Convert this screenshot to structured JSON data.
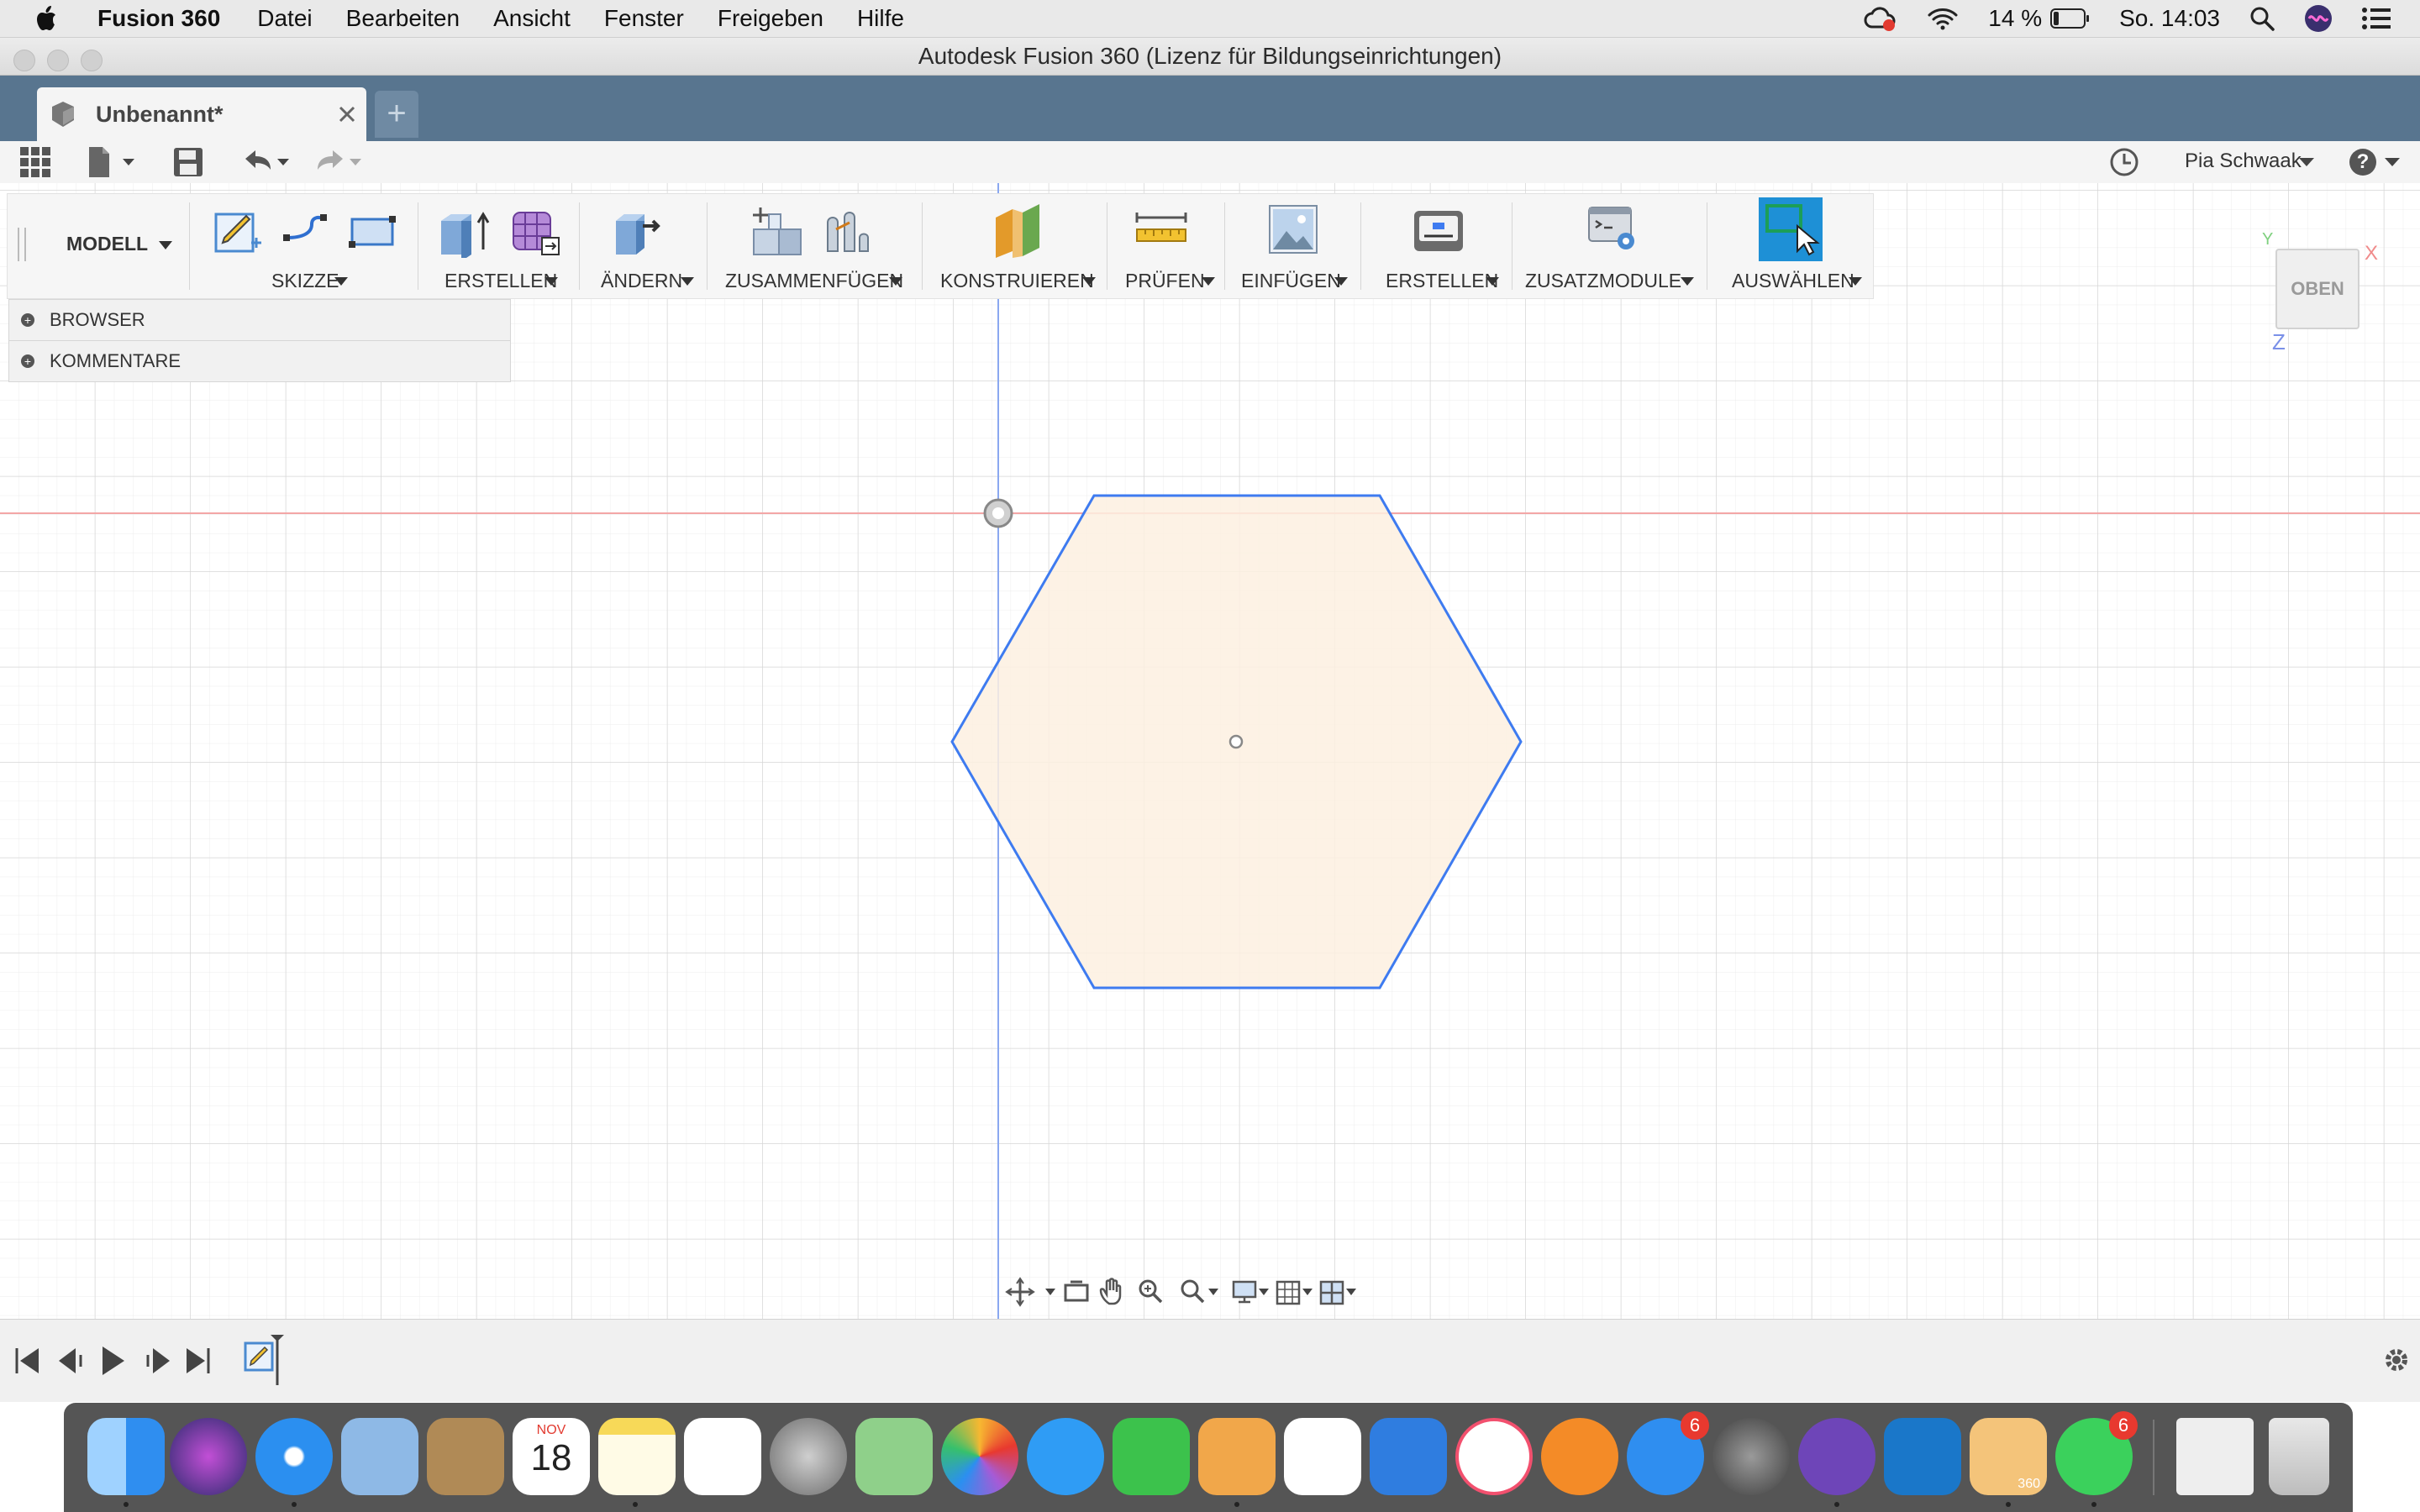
{
  "menubar": {
    "app_name": "Fusion 360",
    "items": [
      "Datei",
      "Bearbeiten",
      "Ansicht",
      "Fenster",
      "Freigeben",
      "Hilfe"
    ],
    "battery": "14 %",
    "clock": "So. 14:03"
  },
  "window": {
    "title": "Autodesk Fusion 360 (Lizenz für Bildungseinrichtungen)"
  },
  "tabs": {
    "document_title": "Unbenannt*",
    "new_tab": "+"
  },
  "app_toolbar": {
    "user_name": "Pia Schwaak",
    "help": "?"
  },
  "ribbon": {
    "workspace": "MODELL",
    "groups": [
      {
        "label": "SKIZZE",
        "icons": [
          "create-sketch-icon",
          "arc-icon",
          "rectangle-icon"
        ]
      },
      {
        "label": "ERSTELLEN",
        "icons": [
          "extrude-icon",
          "form-icon"
        ]
      },
      {
        "label": "ÄNDERN",
        "icons": [
          "press-pull-icon"
        ]
      },
      {
        "label": "ZUSAMMENFÜGEN",
        "icons": [
          "new-component-icon",
          "joint-icon"
        ]
      },
      {
        "label": "KONSTRUIEREN",
        "icons": [
          "offset-plane-icon"
        ]
      },
      {
        "label": "PRÜFEN",
        "icons": [
          "measure-icon"
        ]
      },
      {
        "label": "EINFÜGEN",
        "icons": [
          "insert-image-icon"
        ]
      },
      {
        "label": "ERSTELLEN",
        "icons": [
          "3d-print-icon"
        ]
      },
      {
        "label": "ZUSATZMODULE",
        "icons": [
          "scripts-icon"
        ]
      },
      {
        "label": "AUSWÄHLEN",
        "icons": [
          "select-icon"
        ]
      }
    ]
  },
  "panels": {
    "browser": "BROWSER",
    "comments": "KOMMENTARE"
  },
  "viewcube": {
    "face": "OBEN",
    "axis_x": "X",
    "axis_y": "Y",
    "axis_z": "Z"
  },
  "dock": {
    "calendar_month": "NOV",
    "calendar_day": "18",
    "appstore_badge": "6",
    "whatsapp_badge": "6",
    "fusion_label": "360"
  },
  "colors": {
    "tab_strip": "#58758f",
    "sketch_line": "#3e7bf0",
    "profile_fill": "#fdf0e1",
    "x_axis": "#f3a6a6",
    "y_axis": "#8aa8f0",
    "select_active": "#1e90d6"
  }
}
